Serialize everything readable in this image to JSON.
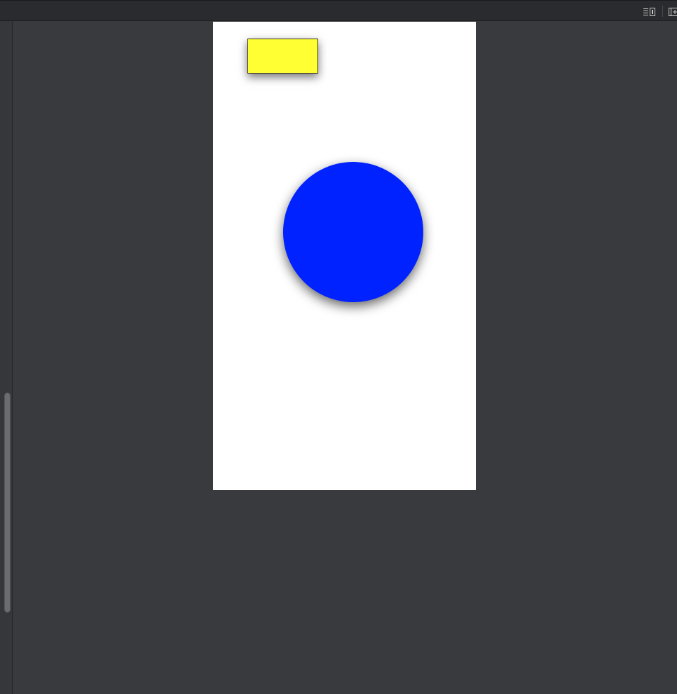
{
  "toolbar": {
    "icons": [
      "list-layout-icon",
      "add-panel-icon"
    ]
  },
  "canvas": {
    "artboard_background": "#ffffff",
    "shapes": [
      {
        "name": "yellow-rectangle",
        "kind": "rectangle",
        "fill": "#ffff33",
        "stroke": "#3a3a20"
      },
      {
        "name": "blue-circle",
        "kind": "circle",
        "fill": "#0022ff"
      }
    ]
  },
  "colors": {
    "workspace": "#393a3e",
    "toolbar": "#2a2b2e",
    "rectangle": "#ffff33",
    "circle": "#0022ff"
  }
}
